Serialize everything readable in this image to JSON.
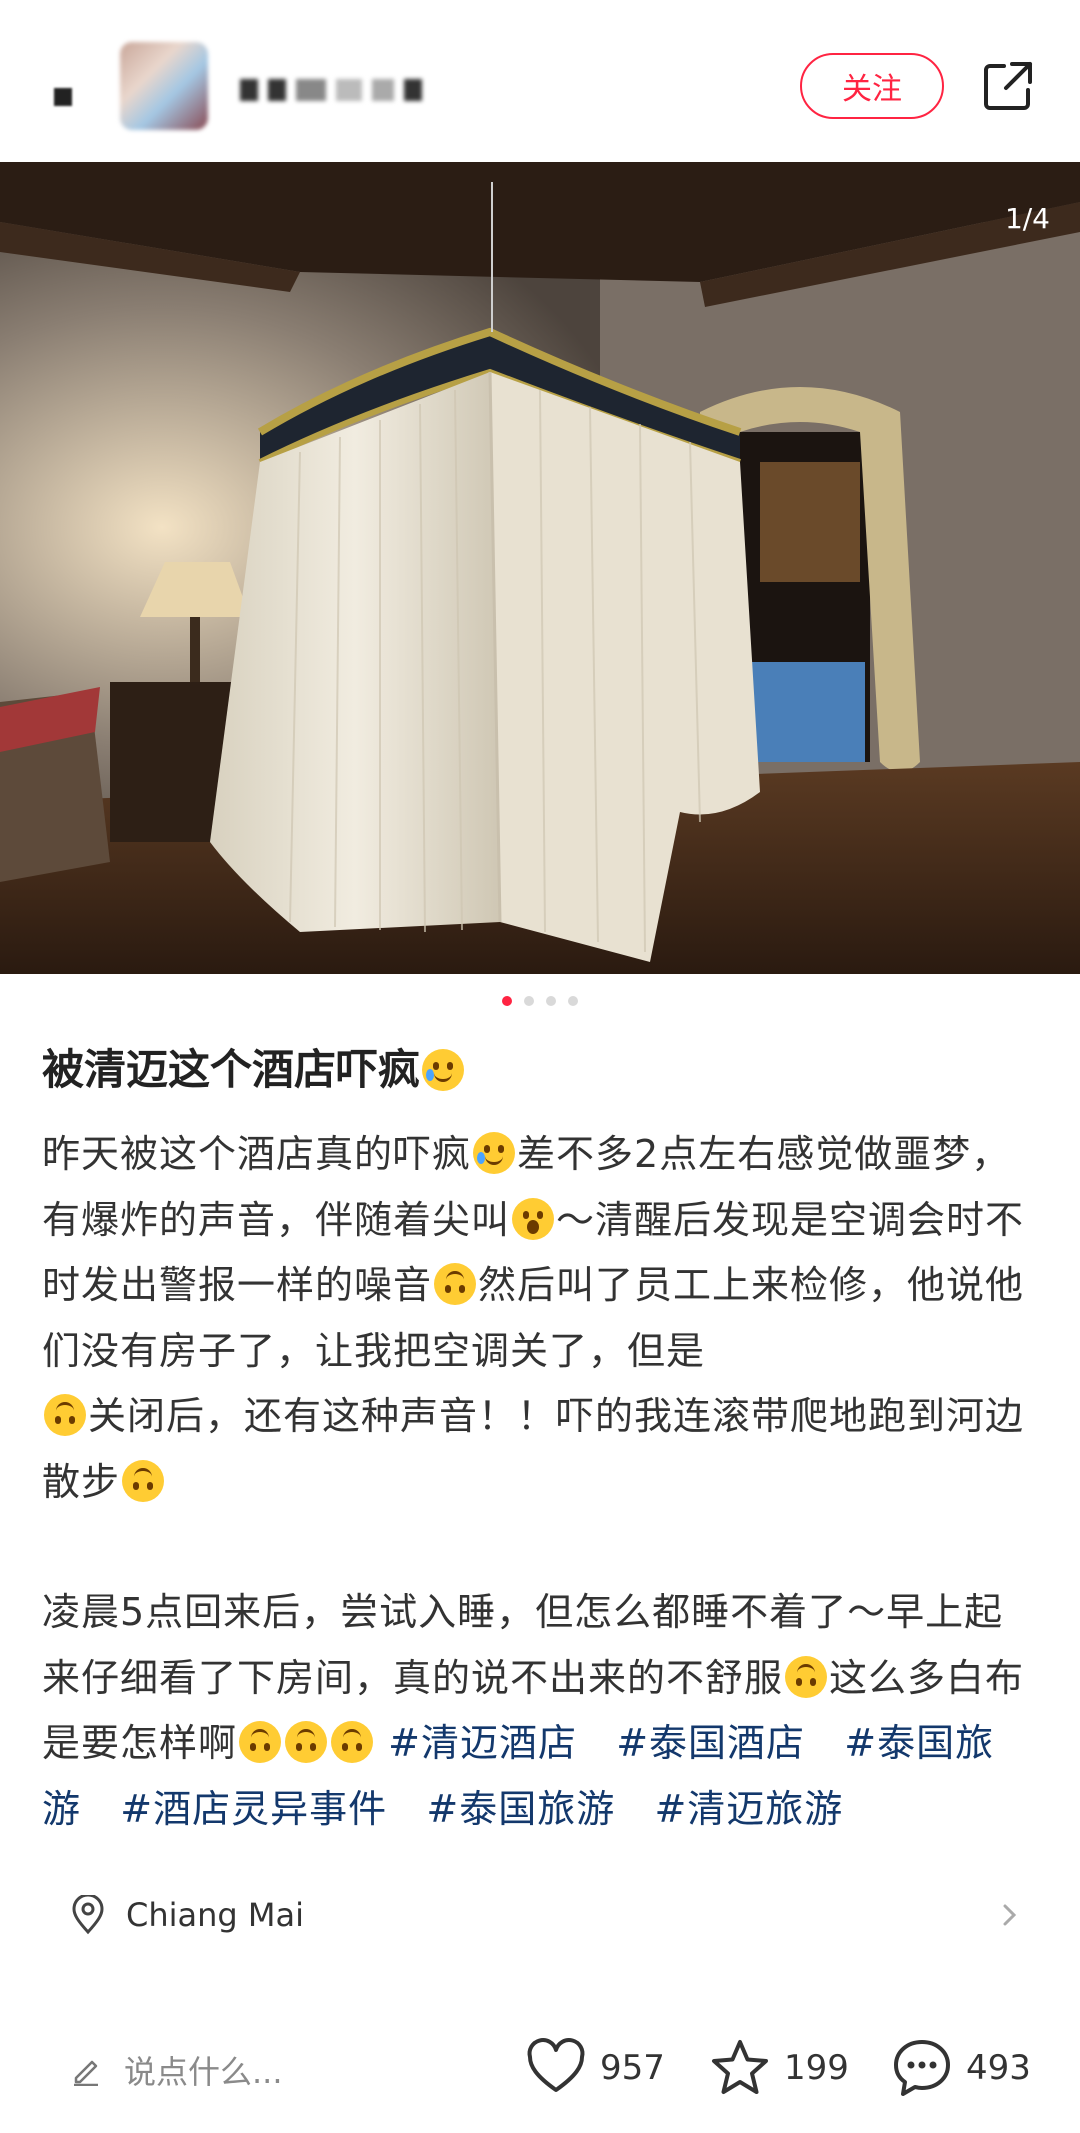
{
  "header": {
    "follow_label": "关注"
  },
  "photo": {
    "counter": "1/4",
    "total_pages": 4,
    "current_page": 1
  },
  "post": {
    "title": "被清迈这个酒店吓疯",
    "body": {
      "p1_a": "昨天被这个酒店真的吓疯",
      "p1_b": "差不多2点左右感觉做噩梦，有爆炸的声音，伴随着尖叫",
      "p1_c": "～清醒后发现是空调会时不时发出警报一样的噪音",
      "p1_d": "然后叫了员工上来检修，他说他们没有房子了，让我把空调关了，但是",
      "p1_e": "关闭后，还有这种声音！！吓的我连滚带爬地跑到河边散步",
      "p2_a": "凌晨5点回来后，尝试入睡，但怎么都睡不着了～早上起来仔细看了下房间，真的说不出来的不舒服",
      "p2_b": "这么多白布是要怎样啊"
    },
    "tags": [
      "#清迈酒店",
      "#泰国酒店",
      "#泰国旅游",
      "#酒店灵异事件",
      "#泰国旅游",
      "#清迈旅游"
    ]
  },
  "location": {
    "name": "Chiang Mai"
  },
  "bottom_bar": {
    "comment_placeholder": "说点什么...",
    "likes": "957",
    "collects": "199",
    "comments": "493"
  },
  "colors": {
    "accent": "#ff2442",
    "tag": "#13386c"
  },
  "icons": [
    "back-icon",
    "share-icon",
    "location-pin-icon",
    "chevron-right-icon",
    "pencil-icon",
    "heart-icon",
    "star-icon",
    "comment-bubble-icon"
  ]
}
